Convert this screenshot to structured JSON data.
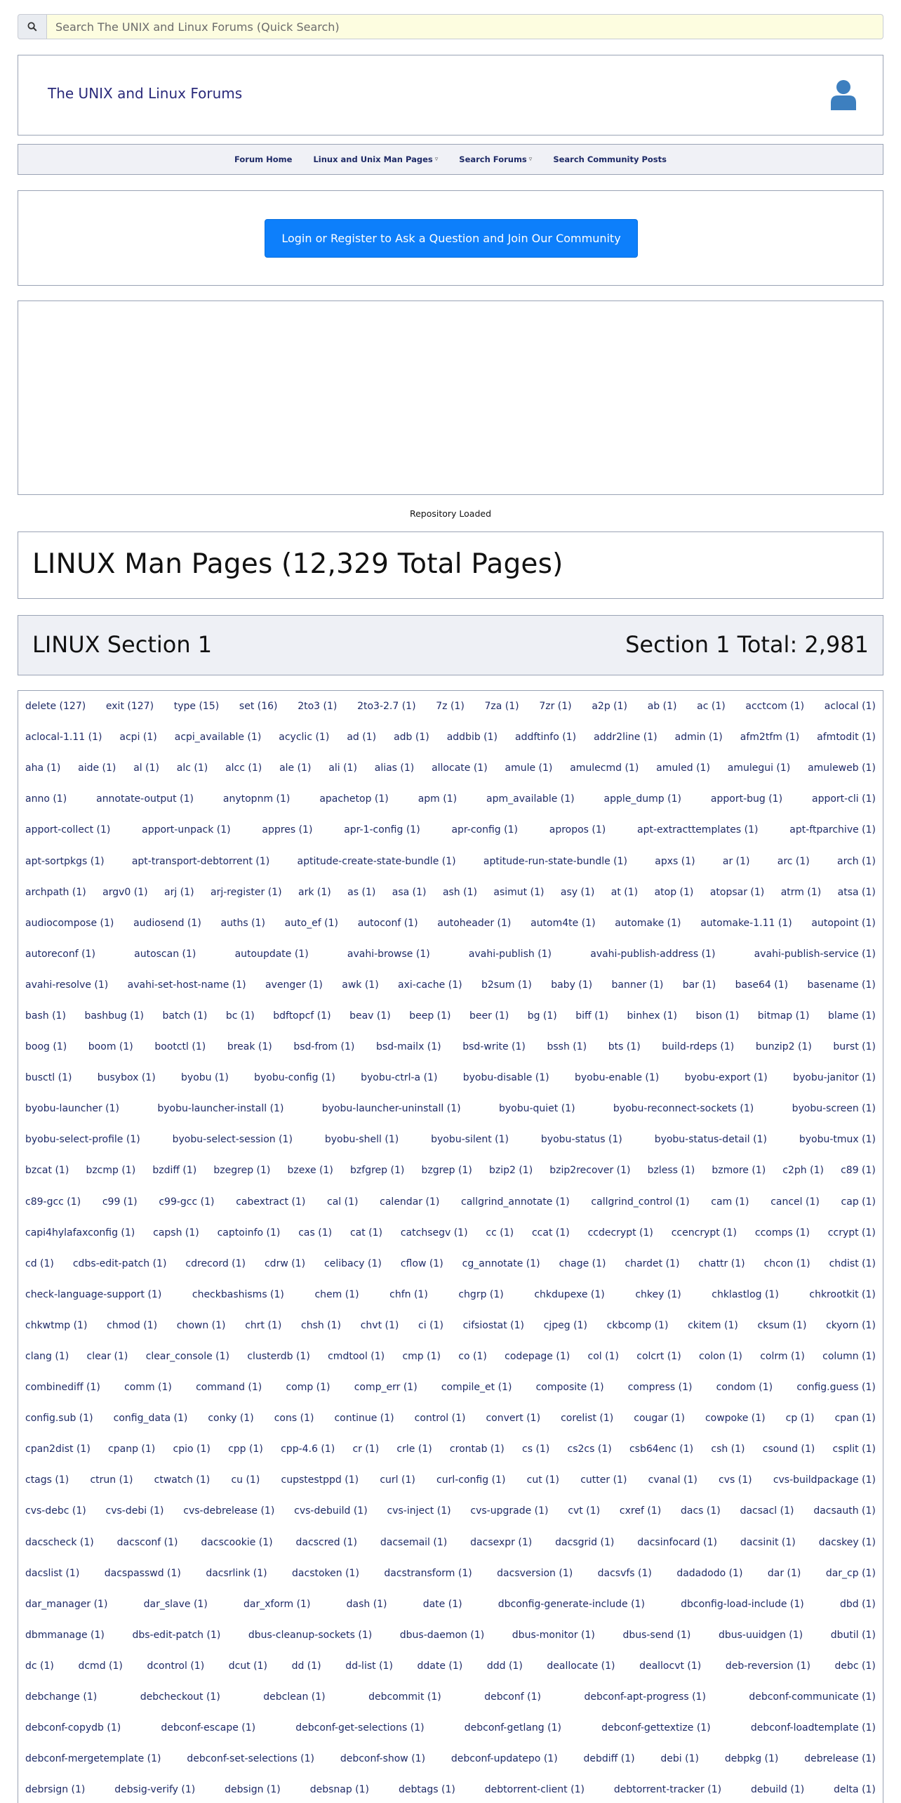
{
  "search": {
    "placeholder": "Search The UNIX and Linux Forums (Quick Search)"
  },
  "header": {
    "site_title": "The UNIX and Linux Forums"
  },
  "nav": [
    {
      "label": "Forum Home",
      "dropdown": false
    },
    {
      "label": "Linux and Unix Man Pages",
      "dropdown": true
    },
    {
      "label": "Search Forums",
      "dropdown": true
    },
    {
      "label": "Search Community Posts",
      "dropdown": false
    }
  ],
  "login": {
    "label": "Login or Register to Ask a Question and Join Our Community"
  },
  "status": {
    "repo_loaded": "Repository Loaded"
  },
  "page": {
    "title": "LINUX Man Pages (12,329 Total Pages)"
  },
  "section": {
    "name": "LINUX Section 1",
    "total": "Section 1 Total: 2,981"
  },
  "colors": {
    "accent": "#0d7ffb",
    "link": "#1e2a66",
    "border": "#9aa3b5",
    "search_bg": "#fdfde0"
  },
  "commands": [
    [
      "delete (127)",
      "exit (127)",
      "type (15)",
      "set (16)",
      "2to3 (1)",
      "2to3-2.7 (1)",
      "7z (1)",
      "7za (1)",
      "7zr (1)",
      "a2p (1)",
      "ab (1)",
      "ac (1)",
      "acctcom (1)",
      "aclocal (1)"
    ],
    [
      "aclocal-1.11 (1)",
      "acpi (1)",
      "acpi_available (1)",
      "acyclic (1)",
      "ad (1)",
      "adb (1)",
      "addbib (1)",
      "addftinfo (1)",
      "addr2line (1)",
      "admin (1)",
      "afm2tfm (1)",
      "afmtodit (1)"
    ],
    [
      "aha (1)",
      "aide (1)",
      "al (1)",
      "alc (1)",
      "alcc (1)",
      "ale (1)",
      "ali (1)",
      "alias (1)",
      "allocate (1)",
      "amule (1)",
      "amulecmd (1)",
      "amuled (1)",
      "amulegui (1)",
      "amuleweb (1)"
    ],
    [
      "anno (1)",
      "annotate-output (1)",
      "anytopnm (1)",
      "apachetop (1)",
      "apm (1)",
      "apm_available (1)",
      "apple_dump (1)",
      "apport-bug (1)",
      "apport-cli (1)"
    ],
    [
      "apport-collect (1)",
      "apport-unpack (1)",
      "appres (1)",
      "apr-1-config (1)",
      "apr-config (1)",
      "apropos (1)",
      "apt-extracttemplates (1)",
      "apt-ftparchive (1)"
    ],
    [
      "apt-sortpkgs (1)",
      "apt-transport-debtorrent (1)",
      "aptitude-create-state-bundle (1)",
      "aptitude-run-state-bundle (1)",
      "apxs (1)",
      "ar (1)",
      "arc (1)",
      "arch (1)"
    ],
    [
      "archpath (1)",
      "argv0 (1)",
      "arj (1)",
      "arj-register (1)",
      "ark (1)",
      "as (1)",
      "asa (1)",
      "ash (1)",
      "asimut (1)",
      "asy (1)",
      "at (1)",
      "atop (1)",
      "atopsar (1)",
      "atrm (1)",
      "atsa (1)"
    ],
    [
      "audiocompose (1)",
      "audiosend (1)",
      "auths (1)",
      "auto_ef (1)",
      "autoconf (1)",
      "autoheader (1)",
      "autom4te (1)",
      "automake (1)",
      "automake-1.11 (1)",
      "autopoint (1)"
    ],
    [
      "autoreconf (1)",
      "autoscan (1)",
      "autoupdate (1)",
      "avahi-browse (1)",
      "avahi-publish (1)",
      "avahi-publish-address (1)",
      "avahi-publish-service (1)"
    ],
    [
      "avahi-resolve (1)",
      "avahi-set-host-name (1)",
      "avenger (1)",
      "awk (1)",
      "axi-cache (1)",
      "b2sum (1)",
      "baby (1)",
      "banner (1)",
      "bar (1)",
      "base64 (1)",
      "basename (1)"
    ],
    [
      "bash (1)",
      "bashbug (1)",
      "batch (1)",
      "bc (1)",
      "bdftopcf (1)",
      "beav (1)",
      "beep (1)",
      "beer (1)",
      "bg (1)",
      "biff (1)",
      "binhex (1)",
      "bison (1)",
      "bitmap (1)",
      "blame (1)"
    ],
    [
      "boog (1)",
      "boom (1)",
      "bootctl (1)",
      "break (1)",
      "bsd-from (1)",
      "bsd-mailx (1)",
      "bsd-write (1)",
      "bssh (1)",
      "bts (1)",
      "build-rdeps (1)",
      "bunzip2 (1)",
      "burst (1)"
    ],
    [
      "busctl (1)",
      "busybox (1)",
      "byobu (1)",
      "byobu-config (1)",
      "byobu-ctrl-a (1)",
      "byobu-disable (1)",
      "byobu-enable (1)",
      "byobu-export (1)",
      "byobu-janitor (1)"
    ],
    [
      "byobu-launcher (1)",
      "byobu-launcher-install (1)",
      "byobu-launcher-uninstall (1)",
      "byobu-quiet (1)",
      "byobu-reconnect-sockets (1)",
      "byobu-screen (1)"
    ],
    [
      "byobu-select-profile (1)",
      "byobu-select-session (1)",
      "byobu-shell (1)",
      "byobu-silent (1)",
      "byobu-status (1)",
      "byobu-status-detail (1)",
      "byobu-tmux (1)"
    ],
    [
      "bzcat (1)",
      "bzcmp (1)",
      "bzdiff (1)",
      "bzegrep (1)",
      "bzexe (1)",
      "bzfgrep (1)",
      "bzgrep (1)",
      "bzip2 (1)",
      "bzip2recover (1)",
      "bzless (1)",
      "bzmore (1)",
      "c2ph (1)",
      "c89 (1)"
    ],
    [
      "c89-gcc (1)",
      "c99 (1)",
      "c99-gcc (1)",
      "cabextract (1)",
      "cal (1)",
      "calendar (1)",
      "callgrind_annotate (1)",
      "callgrind_control (1)",
      "cam (1)",
      "cancel (1)",
      "cap (1)"
    ],
    [
      "capi4hylafaxconfig (1)",
      "capsh (1)",
      "captoinfo (1)",
      "cas (1)",
      "cat (1)",
      "catchsegv (1)",
      "cc (1)",
      "ccat (1)",
      "ccdecrypt (1)",
      "ccencrypt (1)",
      "ccomps (1)",
      "ccrypt (1)"
    ],
    [
      "cd (1)",
      "cdbs-edit-patch (1)",
      "cdrecord (1)",
      "cdrw (1)",
      "celibacy (1)",
      "cflow (1)",
      "cg_annotate (1)",
      "chage (1)",
      "chardet (1)",
      "chattr (1)",
      "chcon (1)",
      "chdist (1)"
    ],
    [
      "check-language-support (1)",
      "checkbashisms (1)",
      "chem (1)",
      "chfn (1)",
      "chgrp (1)",
      "chkdupexe (1)",
      "chkey (1)",
      "chklastlog (1)",
      "chkrootkit (1)"
    ],
    [
      "chkwtmp (1)",
      "chmod (1)",
      "chown (1)",
      "chrt (1)",
      "chsh (1)",
      "chvt (1)",
      "ci (1)",
      "cifsiostat (1)",
      "cjpeg (1)",
      "ckbcomp (1)",
      "ckitem (1)",
      "cksum (1)",
      "ckyorn (1)"
    ],
    [
      "clang (1)",
      "clear (1)",
      "clear_console (1)",
      "clusterdb (1)",
      "cmdtool (1)",
      "cmp (1)",
      "co (1)",
      "codepage (1)",
      "col (1)",
      "colcrt (1)",
      "colon (1)",
      "colrm (1)",
      "column (1)"
    ],
    [
      "combinediff (1)",
      "comm (1)",
      "command (1)",
      "comp (1)",
      "comp_err (1)",
      "compile_et (1)",
      "composite (1)",
      "compress (1)",
      "condom (1)",
      "config.guess (1)"
    ],
    [
      "config.sub (1)",
      "config_data (1)",
      "conky (1)",
      "cons (1)",
      "continue (1)",
      "control (1)",
      "convert (1)",
      "corelist (1)",
      "cougar (1)",
      "cowpoke (1)",
      "cp (1)",
      "cpan (1)"
    ],
    [
      "cpan2dist (1)",
      "cpanp (1)",
      "cpio (1)",
      "cpp (1)",
      "cpp-4.6 (1)",
      "cr (1)",
      "crle (1)",
      "crontab (1)",
      "cs (1)",
      "cs2cs (1)",
      "csb64enc (1)",
      "csh (1)",
      "csound (1)",
      "csplit (1)"
    ],
    [
      "ctags (1)",
      "ctrun (1)",
      "ctwatch (1)",
      "cu (1)",
      "cupstestppd (1)",
      "curl (1)",
      "curl-config (1)",
      "cut (1)",
      "cutter (1)",
      "cvanal (1)",
      "cvs (1)",
      "cvs-buildpackage (1)"
    ],
    [
      "cvs-debc (1)",
      "cvs-debi (1)",
      "cvs-debrelease (1)",
      "cvs-debuild (1)",
      "cvs-inject (1)",
      "cvs-upgrade (1)",
      "cvt (1)",
      "cxref (1)",
      "dacs (1)",
      "dacsacl (1)",
      "dacsauth (1)"
    ],
    [
      "dacscheck (1)",
      "dacsconf (1)",
      "dacscookie (1)",
      "dacscred (1)",
      "dacsemail (1)",
      "dacsexpr (1)",
      "dacsgrid (1)",
      "dacsinfocard (1)",
      "dacsinit (1)",
      "dacskey (1)"
    ],
    [
      "dacslist (1)",
      "dacspasswd (1)",
      "dacsrlink (1)",
      "dacstoken (1)",
      "dacstransform (1)",
      "dacsversion (1)",
      "dacsvfs (1)",
      "dadadodo (1)",
      "dar (1)",
      "dar_cp (1)"
    ],
    [
      "dar_manager (1)",
      "dar_slave (1)",
      "dar_xform (1)",
      "dash (1)",
      "date (1)",
      "dbconfig-generate-include (1)",
      "dbconfig-load-include (1)",
      "dbd (1)"
    ],
    [
      "dbmmanage (1)",
      "dbs-edit-patch (1)",
      "dbus-cleanup-sockets (1)",
      "dbus-daemon (1)",
      "dbus-monitor (1)",
      "dbus-send (1)",
      "dbus-uuidgen (1)",
      "dbutil (1)"
    ],
    [
      "dc (1)",
      "dcmd (1)",
      "dcontrol (1)",
      "dcut (1)",
      "dd (1)",
      "dd-list (1)",
      "ddate (1)",
      "ddd (1)",
      "deallocate (1)",
      "deallocvt (1)",
      "deb-reversion (1)",
      "debc (1)"
    ],
    [
      "debchange (1)",
      "debcheckout (1)",
      "debclean (1)",
      "debcommit (1)",
      "debconf (1)",
      "debconf-apt-progress (1)",
      "debconf-communicate (1)"
    ],
    [
      "debconf-copydb (1)",
      "debconf-escape (1)",
      "debconf-get-selections (1)",
      "debconf-getlang (1)",
      "debconf-gettextize (1)",
      "debconf-loadtemplate (1)"
    ],
    [
      "debconf-mergetemplate (1)",
      "debconf-set-selections (1)",
      "debconf-show (1)",
      "debconf-updatepo (1)",
      "debdiff (1)",
      "debi (1)",
      "debpkg (1)",
      "debrelease (1)"
    ],
    [
      "debrsign (1)",
      "debsig-verify (1)",
      "debsign (1)",
      "debsnap (1)",
      "debtags (1)",
      "debtorrent-client (1)",
      "debtorrent-tracker (1)",
      "debuild (1)",
      "delta (1)"
    ]
  ]
}
